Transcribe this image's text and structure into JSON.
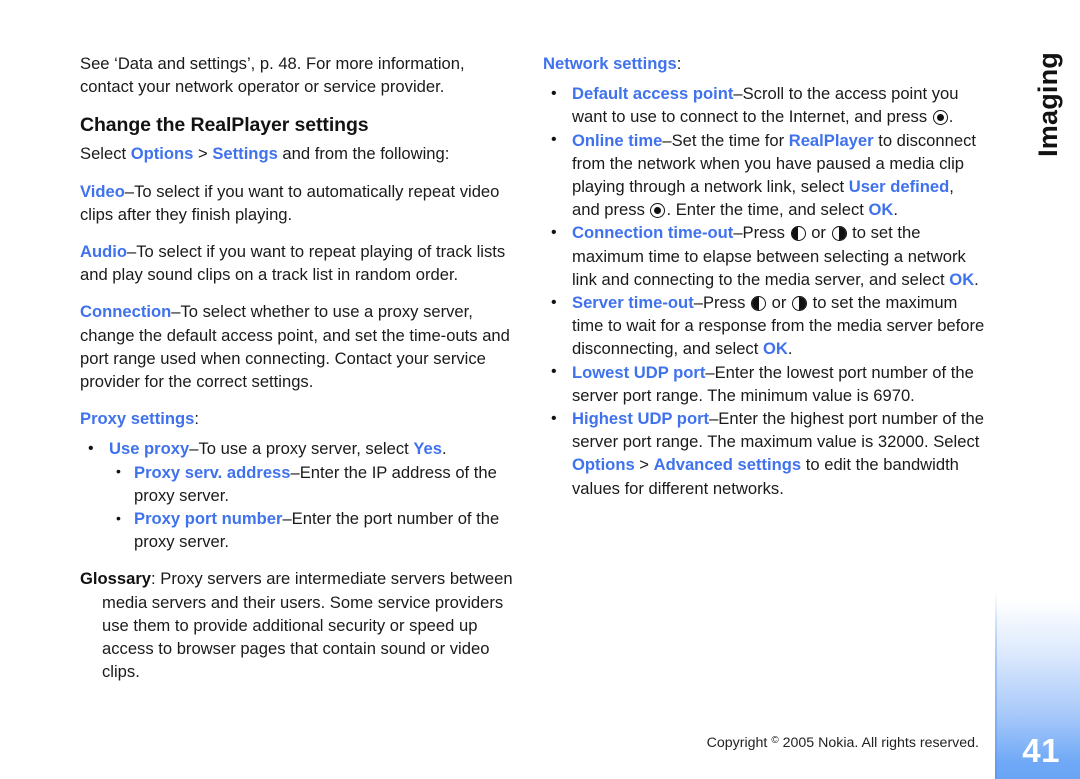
{
  "document": {
    "chapter_tab": "Imaging",
    "page_number": "41",
    "footer": {
      "prefix": "Copyright ",
      "symbol": "©",
      "suffix": " 2005 Nokia. All rights reserved."
    },
    "accent_color": "#3f72ec",
    "tab_color": "#6aa5f5"
  },
  "left_column": {
    "intro": "See ‘Data and settings’, p. 48. For more information, contact your network operator or service provider.",
    "heading": "Change the RealPlayer settings",
    "select_line": {
      "prefix": "Select ",
      "link1": "Options",
      "separator": " > ",
      "link2": "Settings",
      "suffix": " and from the following:"
    },
    "video": {
      "term": "Video",
      "text": "–To select if you want to automatically repeat video clips after they finish playing."
    },
    "audio": {
      "term": "Audio",
      "text": "–To select if you want to repeat playing of track lists and play sound clips on a track list in random order."
    },
    "connection": {
      "term": "Connection",
      "text": "–To select whether to use a proxy server, change the default access point, and set the time-outs and port range used when connecting. Contact your service provider for the correct settings."
    },
    "proxy_settings_label": "Proxy settings",
    "proxy_settings_colon": ":",
    "use_proxy": {
      "term": "Use proxy",
      "text_before": "–To use a proxy server, select ",
      "value": "Yes",
      "text_after": "."
    },
    "proxy_sub_items": [
      {
        "term": "Proxy serv. address",
        "text": "–Enter the IP address of the proxy server."
      },
      {
        "term": "Proxy port number",
        "text": "–Enter the port number of the proxy server."
      }
    ],
    "glossary": {
      "term": "Glossary",
      "text": ": Proxy servers are intermediate servers between media servers and their users. Some service providers use them to provide additional security or speed up access to browser pages that contain sound or video clips."
    }
  },
  "right_column": {
    "network_settings_label": "Network settings",
    "network_settings_colon": ":",
    "default_access_point": {
      "term": "Default access point",
      "text_before": "–Scroll to the access point you want to use to connect to the Internet, and press ",
      "key": "select-key",
      "text_after": "."
    },
    "online_time": {
      "term": "Online time",
      "t1": "–Set the time for ",
      "link1": "RealPlayer",
      "t2": " to disconnect from the network when you have paused a media clip playing through a network link, select ",
      "link2": "User defined",
      "t3": ", and press ",
      "key": "select-key",
      "t4": ". Enter the time, and select ",
      "link3": "OK",
      "t5": "."
    },
    "connection_timeout": {
      "term": "Connection time-out",
      "t1": "–Press ",
      "key_left": "scroll-left-key",
      "t2": " or ",
      "key_right": "scroll-right-key",
      "t3": " to set the maximum time to elapse between selecting a network link and connecting to the media server, and select ",
      "link": "OK",
      "t4": "."
    },
    "server_timeout": {
      "term": "Server time-out",
      "t1": "–Press ",
      "key_left": "scroll-left-key",
      "t2": " or ",
      "key_right": "scroll-right-key",
      "t3": " to set the maximum time to wait for a response from the media server before disconnecting, and select ",
      "link": "OK",
      "t4": "."
    },
    "lowest_udp_port": {
      "term": "Lowest UDP port",
      "text": "–Enter the lowest port number of the server port range. The minimum value is 6970."
    },
    "highest_udp_port": {
      "term": "Highest UDP port",
      "t1": "–Enter the highest port number of the server port range. The maximum value is 32000. Select ",
      "link1": "Options",
      "sep": " > ",
      "link2": "Advanced settings",
      "t2": " to edit the bandwidth values for different networks."
    }
  }
}
